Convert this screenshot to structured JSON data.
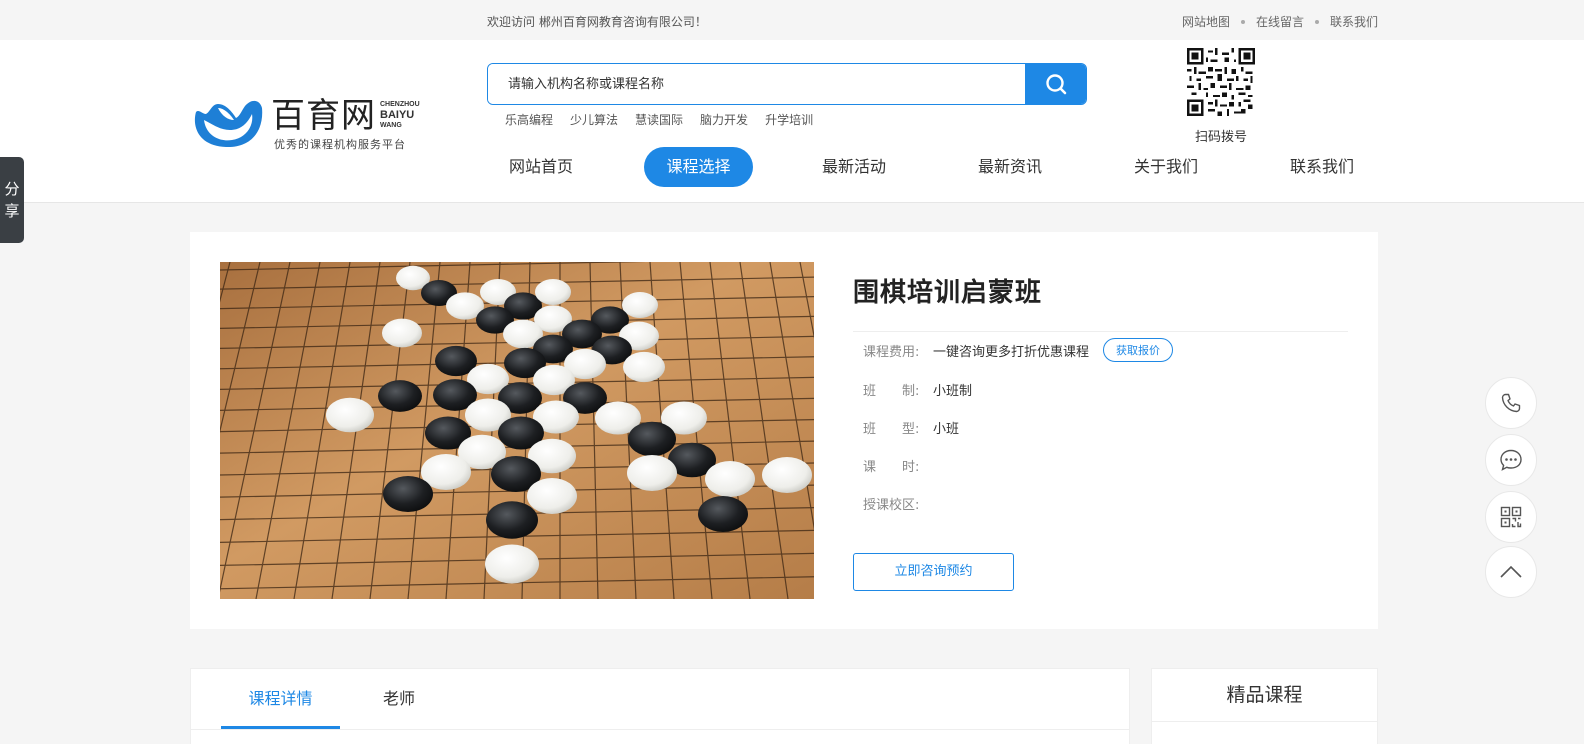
{
  "topbar": {
    "welcome": "欢迎访问 郴州百育网教育咨询有限公司！",
    "links": [
      "网站地图",
      "在线留言",
      "联系我们"
    ]
  },
  "logo": {
    "name_cn": "百育网",
    "name_en_1": "CHENZHOU",
    "name_en_2": "BAIYU",
    "name_en_3": "WANG",
    "slogan": "优秀的课程机构服务平台"
  },
  "search": {
    "placeholder": "请输入机构名称或课程名称",
    "hotwords": [
      "乐高编程",
      "少儿算法",
      "慧读国际",
      "脑力开发",
      "升学培训"
    ]
  },
  "qr": {
    "label": "扫码拨号"
  },
  "nav": {
    "items": [
      "网站首页",
      "课程选择",
      "最新活动",
      "最新资讯",
      "关于我们",
      "联系我们"
    ],
    "active": "课程选择"
  },
  "share": {
    "label_1": "分",
    "label_2": "享"
  },
  "course": {
    "title": "围棋培训启蒙班",
    "fee_label": "课程费用:",
    "fee_value": "一键咨询更多打折优惠课程",
    "price_button": "获取报价",
    "system_label": "班　　制:",
    "system_value": "小班制",
    "type_label": "班　　型:",
    "type_value": "小班",
    "hours_label": "课　　时:",
    "hours_value": "",
    "campus_label": "授课校区:",
    "campus_value": "",
    "consult_button": "立即咨询预约"
  },
  "floating": [
    "phone-icon",
    "chat-icon",
    "qrcode-icon",
    "back-to-top-icon"
  ],
  "detail_tabs": [
    "课程详情",
    "老师"
  ],
  "featured": {
    "title": "精品课程"
  },
  "colors": {
    "accent": "#1e88e5",
    "board": "#c58a52"
  }
}
